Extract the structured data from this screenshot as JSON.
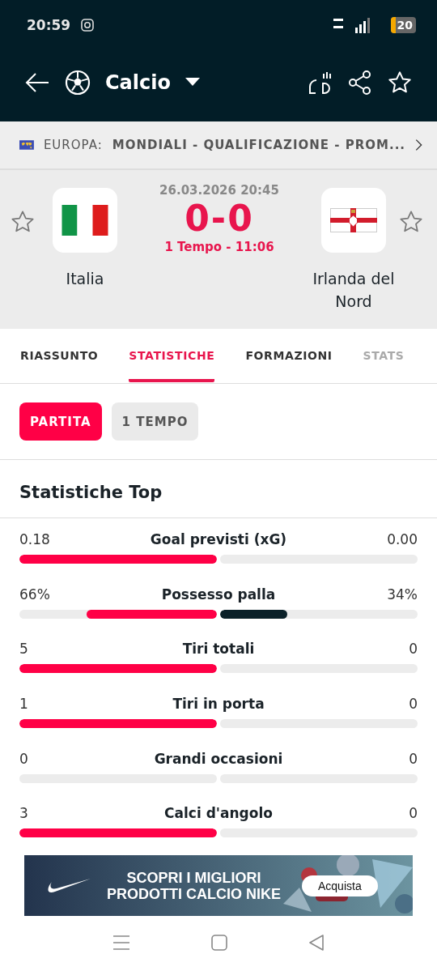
{
  "status_bar": {
    "time": "20:59",
    "battery": "20"
  },
  "toolbar": {
    "title": "Calcio"
  },
  "competition": {
    "region": "EUROPA:",
    "name": "MONDIALI - QUALIFICAZIONE - PROM..."
  },
  "match": {
    "datetime": "26.03.2026 20:45",
    "score": "0-0",
    "period": "1 Tempo - 11:06",
    "home": {
      "name": "Italia",
      "favorite": false
    },
    "away": {
      "name": "Irlanda del Nord",
      "favorite": false
    }
  },
  "tabs": [
    {
      "label": "RIASSUNTO",
      "selected": false
    },
    {
      "label": "STATISTICHE",
      "selected": true
    },
    {
      "label": "FORMAZIONI",
      "selected": false
    },
    {
      "label": "STATS",
      "selected": false
    }
  ],
  "periods": [
    {
      "label": "PARTITA",
      "selected": true
    },
    {
      "label": "1 TEMPO",
      "selected": false
    }
  ],
  "stats_section": {
    "title": "Statistiche Top",
    "stats": [
      {
        "label": "Goal previsti (xG)",
        "home": "0.18",
        "away": "0.00",
        "home_bar": {
          "level": 1
        }
      },
      {
        "label": "Possesso palla",
        "home": "66%",
        "away": "34%",
        "home_bar": {
          "level": 0.66
        },
        "away_bar": {
          "level": 0.34
        }
      },
      {
        "label": "Tiri totali",
        "home": "5",
        "away": "0",
        "home_bar": {
          "level": 1
        }
      },
      {
        "label": "Tiri in porta",
        "home": "1",
        "away": "0",
        "home_bar": {
          "level": 1
        }
      },
      {
        "label": "Grandi occasioni",
        "home": "0",
        "away": "0"
      },
      {
        "label": "Calci d'angolo",
        "home": "3",
        "away": "0",
        "home_bar": {
          "level": 1
        }
      }
    ]
  },
  "ad": {
    "headline": [
      "SCOPRI I MIGLIORI",
      "PRODOTTI CALCIO NIKE"
    ],
    "button": "Acquista"
  }
}
